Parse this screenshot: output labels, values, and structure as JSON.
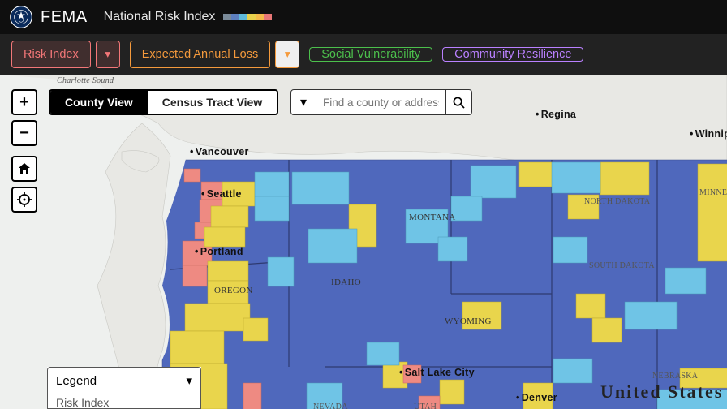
{
  "header": {
    "agency": "FEMA",
    "title": "National Risk Index",
    "palette": [
      "#7a8a99",
      "#5d7fbe",
      "#5fbad9",
      "#e8d14b",
      "#f4b94a",
      "#e87777"
    ]
  },
  "nav": {
    "risk_index": "Risk Index",
    "expected_annual_loss": "Expected Annual Loss",
    "social_vulnerability": "Social Vulnerability",
    "community_resilience": "Community Resilience",
    "caret": "▾"
  },
  "controls": {
    "zoom_in": "+",
    "zoom_out": "−",
    "home_icon": "⌂",
    "locate_icon": "⌖",
    "search_dd_icon": "▾",
    "search_icon_title": "search",
    "legend_caret": "▾"
  },
  "view": {
    "county": "County View",
    "tract": "Census Tract View"
  },
  "search": {
    "placeholder": "Find a county or address"
  },
  "legend": {
    "title": "Legend",
    "item0": "Risk Index"
  },
  "map_labels": {
    "charlotte_sound": "Charlotte Sound",
    "regina": "Regina",
    "winnipeg": "Winnipeg",
    "vancouver": "Vancouver",
    "seattle": "Seattle",
    "portland": "Portland",
    "oregon": "OREGON",
    "montana": "MONTANA",
    "idaho": "IDAHO",
    "wyoming": "WYOMING",
    "north_dakota": "NORTH DAKOTA",
    "south_dakota": "SOUTH DAKOTA",
    "salt_lake_city": "Salt Lake City",
    "nevada": "NEVADA",
    "utah": "UTAH",
    "denver": "Denver",
    "nebraska": "NEBRASKA",
    "united_states": "United States",
    "minnesota": "MINNESOTA"
  }
}
